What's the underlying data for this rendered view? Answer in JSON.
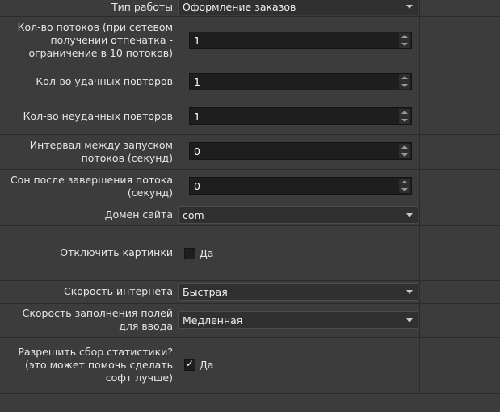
{
  "settings": {
    "work_type": {
      "label": "Тип работы",
      "value": "Оформление заказов"
    },
    "threads": {
      "label": "Кол-во потоков (при сетевом получении отпечатка - ограничение в 10 потоков)",
      "value": "1"
    },
    "success_retries": {
      "label": "Кол-во удачных повторов",
      "value": "1"
    },
    "fail_retries": {
      "label": "Кол-во неудачных повторов",
      "value": "1"
    },
    "thread_interval": {
      "label": "Интервал между запуском потоков (секунд)",
      "value": "0"
    },
    "sleep_after": {
      "label": "Сон после завершения потока (секунд)",
      "value": "0"
    },
    "site_domain": {
      "label": "Домен сайта",
      "value": "com"
    },
    "disable_images": {
      "label": "Отключить картинки",
      "option": "Да",
      "checked": false
    },
    "internet_speed": {
      "label": "Скорость интернета",
      "value": "Быстрая"
    },
    "fill_speed": {
      "label": "Скорость заполнения полей для ввода",
      "value": "Медленная"
    },
    "allow_stats": {
      "label": "Разрешить сбор статистики? (это может помочь сделать софт лучше)",
      "option": "Да",
      "checked": true,
      "mark": "✓"
    }
  }
}
